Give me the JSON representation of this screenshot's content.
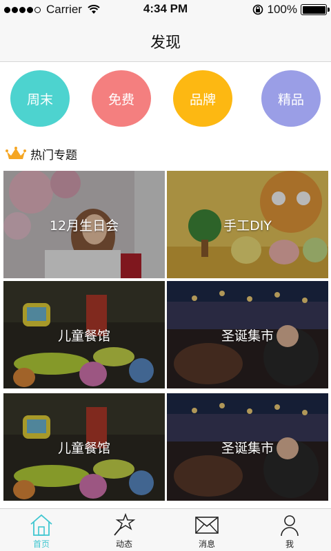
{
  "status_bar": {
    "carrier": "Carrier",
    "time": "4:34 PM",
    "battery": "100%",
    "signal_icon": "signal-dots-icon",
    "wifi_icon": "wifi-icon",
    "lock_icon": "rotation-lock-icon",
    "battery_icon": "battery-icon"
  },
  "nav": {
    "title": "发现"
  },
  "categories": [
    {
      "label": "周末",
      "color": "#4dd3cf"
    },
    {
      "label": "免费",
      "color": "#f47f7f"
    },
    {
      "label": "品牌",
      "color": "#fdb812"
    },
    {
      "label": "精品",
      "color": "#9a9ee6"
    }
  ],
  "section": {
    "title": "热门专题",
    "icon": "crown-icon"
  },
  "topics": [
    {
      "label": "12月生日会",
      "image": "birthday-girl-balloons"
    },
    {
      "label": "手工DIY",
      "image": "handmade-toys"
    },
    {
      "label": "儿童餐馆",
      "image": "kids-restaurant"
    },
    {
      "label": "圣诞集市",
      "image": "christmas-market"
    },
    {
      "label": "儿童餐馆",
      "image": "kids-restaurant"
    },
    {
      "label": "圣诞集市",
      "image": "christmas-market"
    }
  ],
  "tabs": [
    {
      "label": "首页",
      "icon": "home-icon",
      "active": true
    },
    {
      "label": "动态",
      "icon": "star-wand-icon",
      "active": false
    },
    {
      "label": "消息",
      "icon": "envelope-icon",
      "active": false
    },
    {
      "label": "我",
      "icon": "person-icon",
      "active": false
    }
  ],
  "colors": {
    "accent": "#3ec6d0",
    "crown": "#f5a623"
  }
}
